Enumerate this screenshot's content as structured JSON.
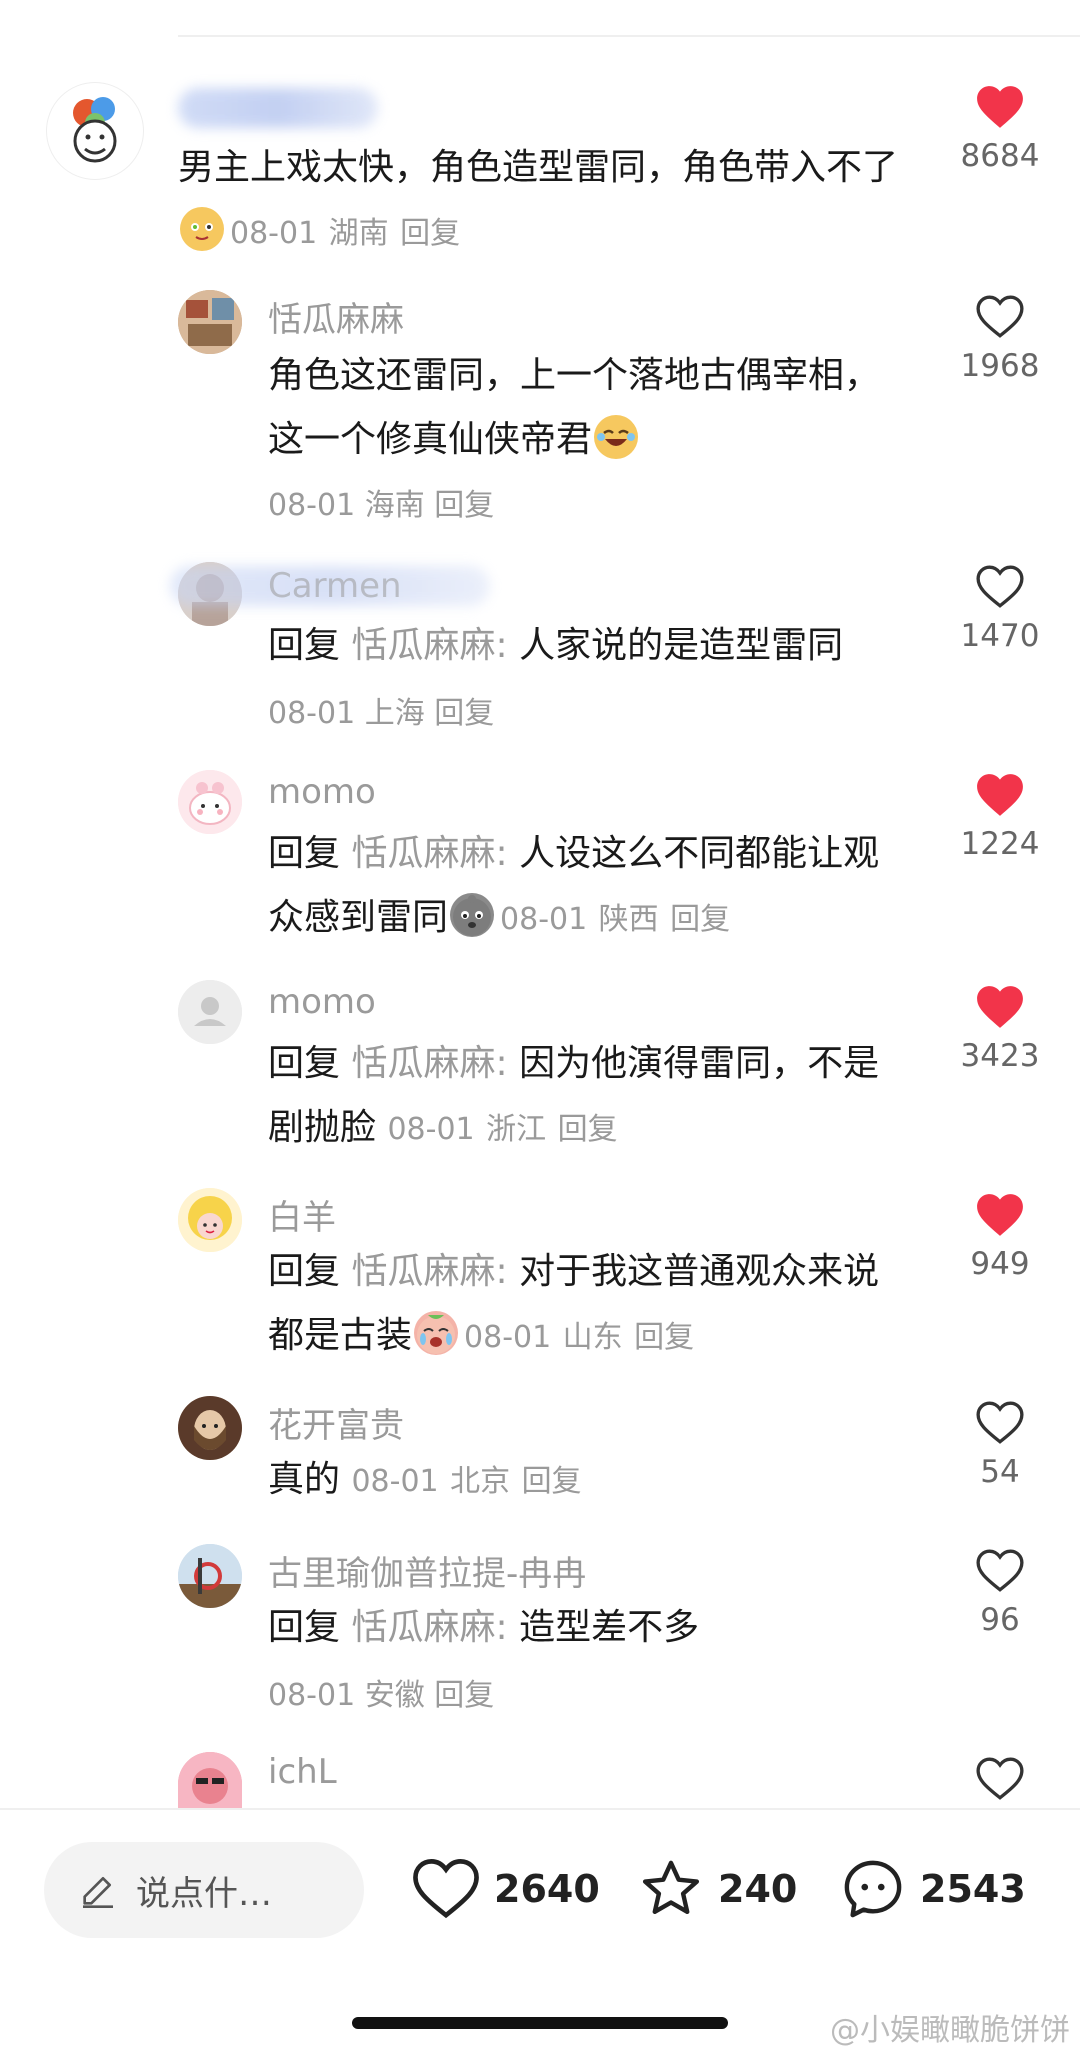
{
  "comments": [
    {
      "name": "",
      "text": "男主上戏太快，角色造型雷同，角色带入不了",
      "date": "08-01",
      "location": "湖南",
      "reply_label": "回复",
      "likes": "8684",
      "liked": true
    },
    {
      "name": "恬瓜麻麻",
      "text": "角色这还雷同，上一个落地古偶宰相，这一个修真仙侠帝君",
      "date": "08-01",
      "location": "海南",
      "reply_label": "回复",
      "likes": "1968",
      "liked": false
    },
    {
      "name": "Carmen",
      "reply_prefix": "回复",
      "reply_target": "恬瓜麻麻:",
      "text": "人家说的是造型雷同",
      "date": "08-01",
      "location": "上海",
      "reply_label": "回复",
      "likes": "1470",
      "liked": false
    },
    {
      "name": "momo",
      "reply_prefix": "回复",
      "reply_target": "恬瓜麻麻:",
      "text": "人设这么不同都能让观众感到雷同",
      "date": "08-01",
      "location": "陕西",
      "reply_label": "回复",
      "likes": "1224",
      "liked": true
    },
    {
      "name": "momo",
      "reply_prefix": "回复",
      "reply_target": "恬瓜麻麻:",
      "text": "因为他演得雷同，不是剧抛脸",
      "date": "08-01",
      "location": "浙江",
      "reply_label": "回复",
      "likes": "3423",
      "liked": true
    },
    {
      "name": "白羊",
      "reply_prefix": "回复",
      "reply_target": "恬瓜麻麻:",
      "text": "对于我这普通观众来说都是古装",
      "date": "08-01",
      "location": "山东",
      "reply_label": "回复",
      "likes": "949",
      "liked": true
    },
    {
      "name": "花开富贵",
      "text": "真的",
      "date": "08-01",
      "location": "北京",
      "reply_label": "回复",
      "likes": "54",
      "liked": false
    },
    {
      "name": "古里瑜伽普拉提-冉冉",
      "reply_prefix": "回复",
      "reply_target": "恬瓜麻麻:",
      "text": "造型差不多",
      "date": "08-01",
      "location": "安徽",
      "reply_label": "回复",
      "likes": "96",
      "liked": false
    },
    {
      "name": "ichL",
      "liked": false
    }
  ],
  "bottom_bar": {
    "input_placeholder": "说点什…",
    "likes": "2640",
    "favorites": "240",
    "comments": "2543"
  },
  "watermark": "@小娱瞰瞰脆饼饼",
  "colors": {
    "liked_heart": "#f2344a",
    "muted_text": "#9a9a9a"
  }
}
